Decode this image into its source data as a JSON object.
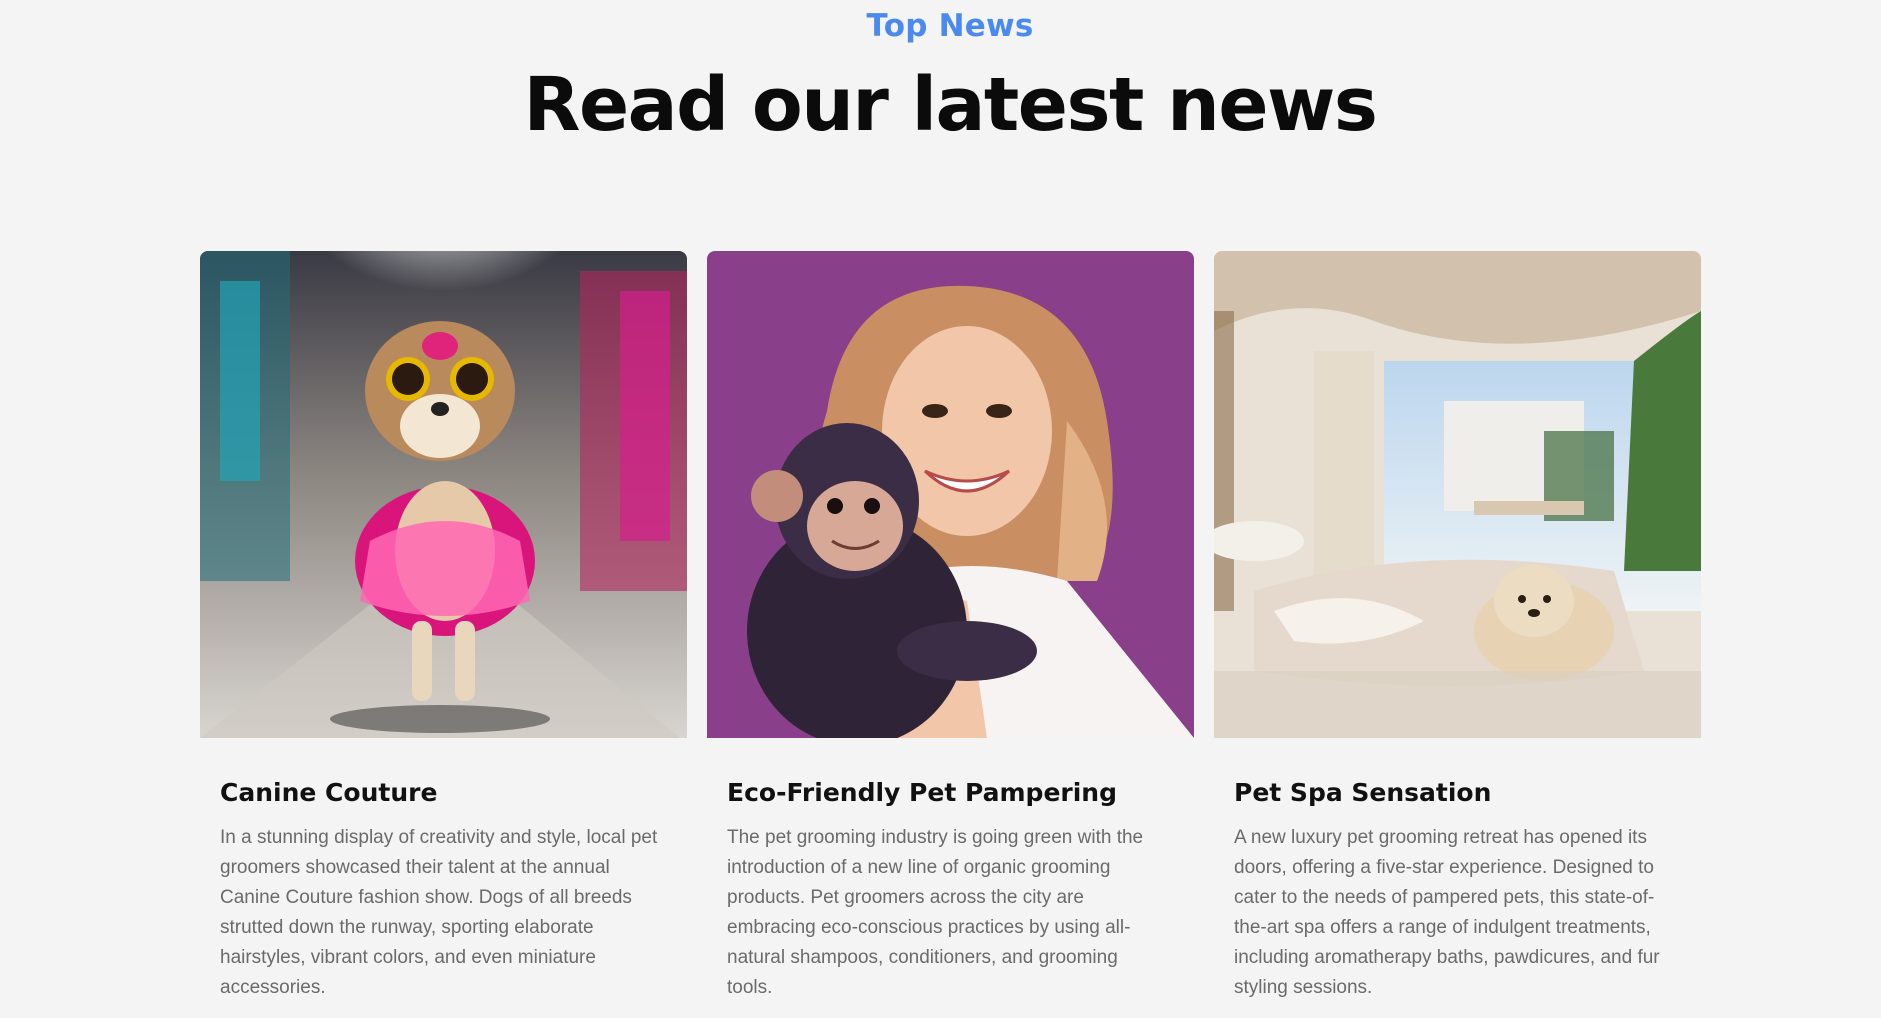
{
  "section": {
    "eyebrow": "Top News",
    "title": "Read our latest news"
  },
  "cards": [
    {
      "image_icon": "dog-fashion-runway-image",
      "title": "Canine Couture",
      "text": "In a stunning display of creativity and style, local pet groomers showcased their talent at the annual Canine Couture fashion show. Dogs of all breeds strutted down the runway, sporting elaborate hairstyles, vibrant colors, and even miniature accessories."
    },
    {
      "image_icon": "woman-with-chimp-image",
      "title": "Eco-Friendly Pet Pampering",
      "text": "The pet grooming industry is going green with the introduction of a new line of organic grooming products. Pet groomers across the city are embracing eco-conscious practices by using all-natural shampoos, conditioners, and grooming tools."
    },
    {
      "image_icon": "luxury-pet-spa-image",
      "title": "Pet Spa Sensation",
      "text": "A new luxury pet grooming retreat has opened its doors, offering a five-star experience. Designed to cater to the needs of pampered pets, this state-of-the-art spa offers a range of indulgent treatments, including aromatherapy baths, pawdicures, and fur styling sessions."
    }
  ],
  "colors": {
    "accent": "#4a8af0",
    "background": "#f4f4f4",
    "heading": "#0b0b0b",
    "body_text": "#6a6a6a"
  }
}
